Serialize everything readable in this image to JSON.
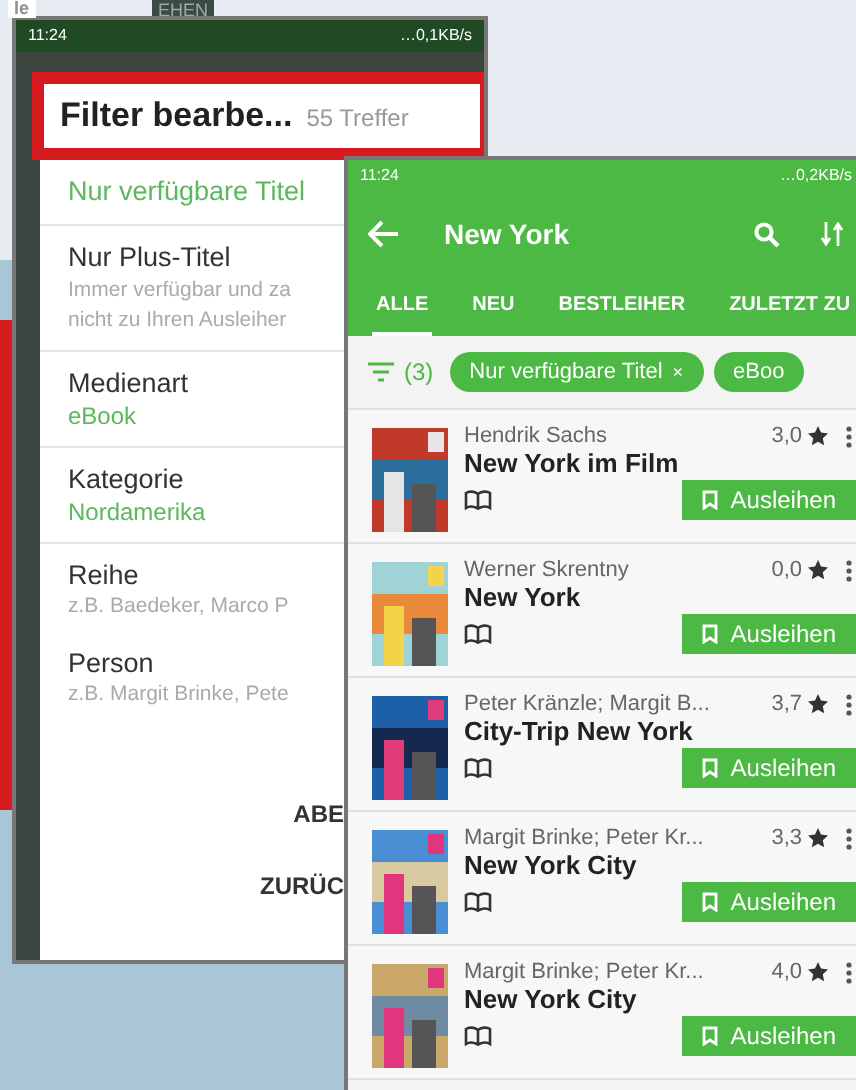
{
  "backdrop": {
    "logo_fragment": "le",
    "banner_fragment": "EHEN"
  },
  "filter_screen": {
    "status_bar": {
      "time": "11:24",
      "speed": "…0,1KB/s"
    },
    "dialog": {
      "title": "Filter bearbe...",
      "count": "55 Treffer",
      "options": [
        {
          "kind": "toggle",
          "label": "Nur verfügbare Titel",
          "active": true
        },
        {
          "kind": "toggle",
          "label": "Nur Plus-Titel",
          "active": false,
          "hint": [
            "Immer verfügbar und za",
            "nicht zu Ihren Ausleiher"
          ]
        },
        {
          "kind": "value",
          "label": "Medienart",
          "value": "eBook"
        },
        {
          "kind": "value",
          "label": "Kategorie",
          "value": "Nordamerika"
        },
        {
          "kind": "field",
          "label": "Reihe",
          "placeholder": "z.B. Baedeker, Marco P"
        },
        {
          "kind": "field",
          "label": "Person",
          "placeholder": "z.B. Margit Brinke, Pete"
        }
      ],
      "actions": [
        "ABE",
        "ZURÜC"
      ]
    }
  },
  "results_screen": {
    "status_bar": {
      "time": "11:24",
      "speed": "…0,2KB/s"
    },
    "toolbar": {
      "title": "New York"
    },
    "tabs": [
      {
        "label": "ALLE",
        "selected": true
      },
      {
        "label": "NEU",
        "selected": false
      },
      {
        "label": "BESTLEIHER",
        "selected": false
      },
      {
        "label": "ZULETZT ZU",
        "selected": false
      }
    ],
    "filter_count": "(3)",
    "chips": [
      {
        "label": "Nur verfügbare Titel",
        "close": "×"
      },
      {
        "label": "eBoo"
      }
    ],
    "books": [
      {
        "author": "Hendrik Sachs",
        "title": "New York im Film",
        "rating": "3,0",
        "action": "Ausleihen"
      },
      {
        "author": "Werner Skrentny",
        "title": "New York",
        "rating": "0,0",
        "action": "Ausleihen"
      },
      {
        "author": "Peter Kränzle; Margit B...",
        "title": "City-Trip New York",
        "rating": "3,7",
        "action": "Ausleihen"
      },
      {
        "author": "Margit Brinke; Peter Kr...",
        "title": "New York City",
        "rating": "3,3",
        "action": "Ausleihen"
      },
      {
        "author": "Margit Brinke; Peter Kr...",
        "title": "New York City",
        "rating": "4,0",
        "action": "Ausleihen"
      }
    ]
  }
}
